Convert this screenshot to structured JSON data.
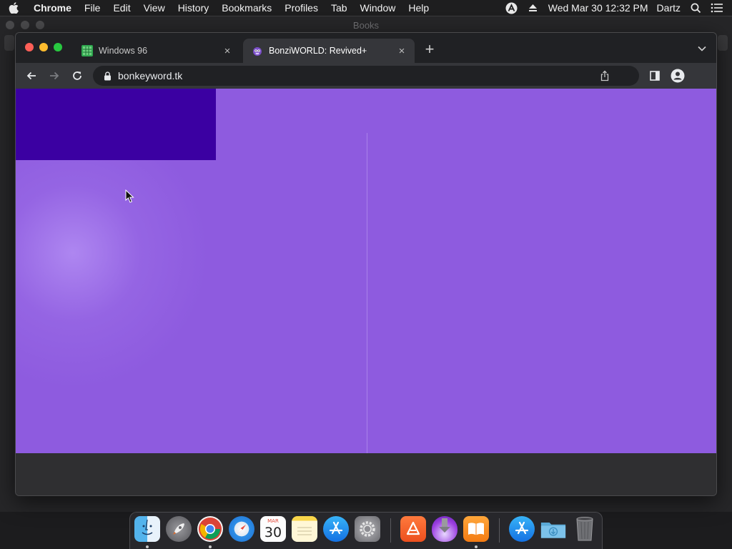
{
  "menubar": {
    "app_name": "Chrome",
    "items": [
      "File",
      "Edit",
      "View",
      "History",
      "Bookmarks",
      "Profiles",
      "Tab",
      "Window",
      "Help"
    ],
    "datetime": "Wed Mar 30  12:32 PM",
    "user": "Dartz"
  },
  "background_window": {
    "title": "Books"
  },
  "browser": {
    "tabs": [
      {
        "title": "Windows 96",
        "favicon": "windows96-favicon",
        "active": false
      },
      {
        "title": "BonziWORLD: Revived+",
        "favicon": "bonziworld-favicon",
        "active": true
      }
    ],
    "new_tab_symbol": "+",
    "close_symbol": "×",
    "address": "bonkeyword.tk"
  },
  "page": {
    "background_color": "#8e5bdf",
    "panel_color": "#3b00a2"
  },
  "calendar": {
    "month": "MAR",
    "day": "30"
  },
  "dock": {
    "icons": [
      "finder-icon",
      "launchpad-icon",
      "chrome-icon",
      "safari-icon",
      "calendar-icon",
      "notes-icon",
      "app-store-icon",
      "system-preferences-icon",
      "pdf-reader-icon",
      "installer-icon",
      "books-icon",
      "app-store-downloads-icon",
      "downloads-folder-icon",
      "trash-icon"
    ],
    "running": [
      "finder-icon",
      "chrome-icon",
      "books-icon"
    ]
  }
}
